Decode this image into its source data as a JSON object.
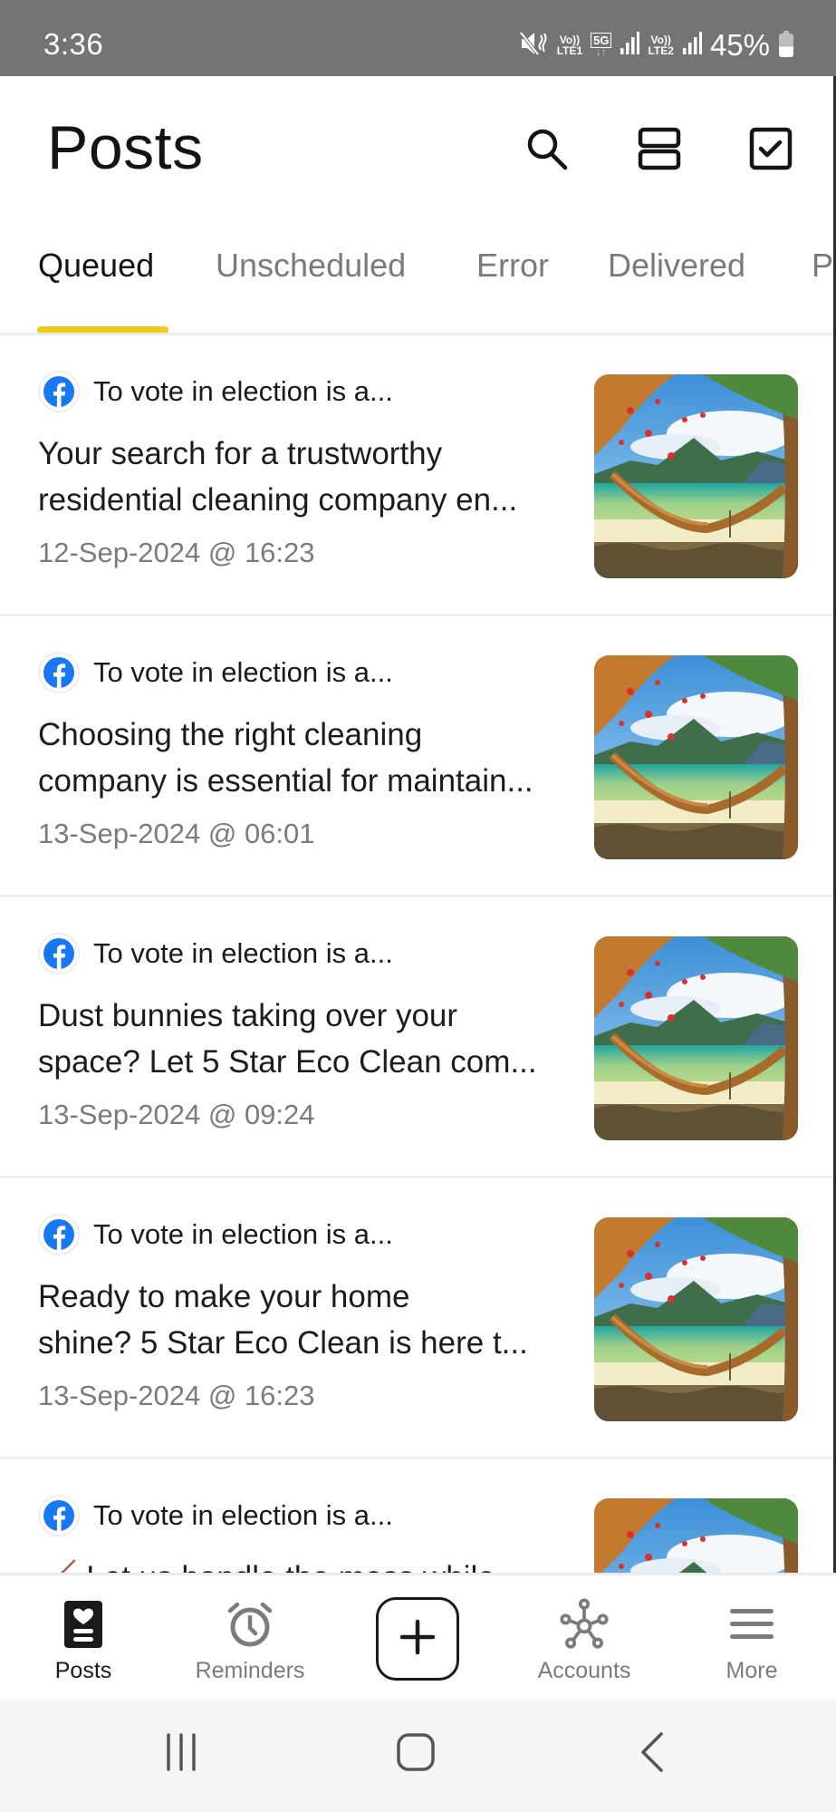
{
  "status_bar": {
    "time": "3:36",
    "volte1": "Vo))",
    "lte1": "LTE1",
    "network": "5G",
    "volte2": "Vo))",
    "lte2": "LTE2",
    "battery": "45%",
    "battery_level": 0.45
  },
  "header": {
    "title": "Posts",
    "icons": [
      "search-icon",
      "layout-toggle-icon",
      "select-checkbox-icon"
    ]
  },
  "tabs": [
    {
      "label": "Queued",
      "active": true
    },
    {
      "label": "Unscheduled",
      "active": false
    },
    {
      "label": "Error",
      "active": false
    },
    {
      "label": "Delivered",
      "active": false
    },
    {
      "label": "Po",
      "active": false
    }
  ],
  "posts": [
    {
      "network_icon": "facebook-icon",
      "title": "To vote in election is a...",
      "body_line1": "Your search for a trustworthy",
      "body_line2": "residential cleaning company en...",
      "date": "12-Sep-2024 @ 16:23"
    },
    {
      "network_icon": "facebook-icon",
      "title": "To vote in election is a...",
      "body_line1": "Choosing the right cleaning",
      "body_line2": "company is essential for maintain...",
      "date": "13-Sep-2024 @ 06:01"
    },
    {
      "network_icon": "facebook-icon",
      "title": "To vote in election is a...",
      "body_line1": "Dust bunnies taking over your",
      "body_line2": "space? Let 5 Star Eco Clean com...",
      "date": "13-Sep-2024 @ 09:24"
    },
    {
      "network_icon": "facebook-icon",
      "title": "To vote in election is a...",
      "body_line1": "Ready to make your home",
      "body_line2": "shine? 5 Star Eco Clean is here t...",
      "date": "13-Sep-2024 @ 16:23"
    },
    {
      "network_icon": "facebook-icon",
      "title": "To vote in election is a...",
      "body_line1": "🧹 Let us handle the mess while...",
      "body_line2": "",
      "date": ""
    }
  ],
  "bottom_nav": {
    "items": [
      {
        "label": "Posts",
        "icon": "posts-icon",
        "active": true
      },
      {
        "label": "Reminders",
        "icon": "alarm-clock-icon",
        "active": false
      },
      {
        "label": "Accounts",
        "icon": "accounts-network-icon",
        "active": false
      },
      {
        "label": "More",
        "icon": "menu-icon",
        "active": false
      }
    ],
    "add_button": "add-post-button"
  },
  "system_nav": [
    "recents",
    "home",
    "back"
  ],
  "colors": {
    "accent": "#f2c81a",
    "facebook": "#1877f2",
    "status_bar": "#747474",
    "muted_text": "#7b7b7b"
  }
}
